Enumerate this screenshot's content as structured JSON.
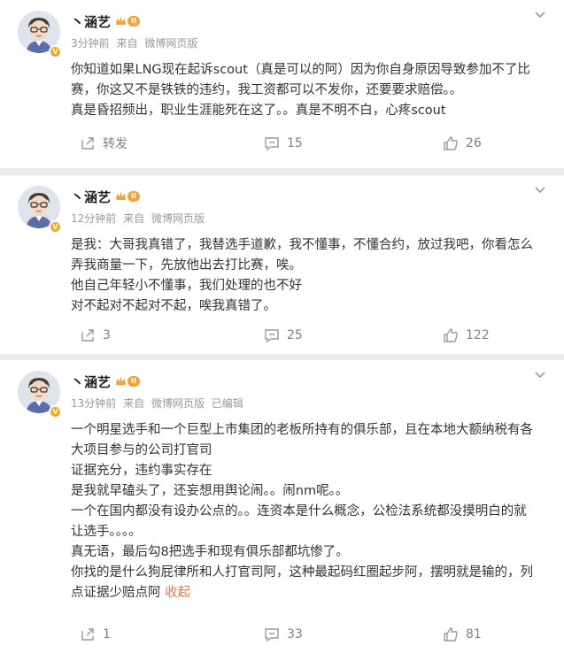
{
  "posts": [
    {
      "user": {
        "name": "丶涵艺",
        "level": "II",
        "verified_badge": "V"
      },
      "meta": {
        "time": "3分钟前",
        "from": "来自",
        "source": "微博网页版",
        "edited": ""
      },
      "lines": [
        "你知道如果LNG现在起诉scout（真是可以的阿）因为你自身原因导致参加不了比",
        "赛，你这又不是铁铁的违约，我工资都可以不发你，还要要求赔偿。。",
        "真是昏招频出，职业生涯能死在这了。。真是不明不白，心疼scout"
      ],
      "collapse_label": "",
      "actions": {
        "repost": "转发",
        "comment": "15",
        "like": "26"
      }
    },
    {
      "user": {
        "name": "丶涵艺",
        "level": "II",
        "verified_badge": "V"
      },
      "meta": {
        "time": "12分钟前",
        "from": "来自",
        "source": "微博网页版",
        "edited": ""
      },
      "lines": [
        "是我：大哥我真错了，我替选手道歉，我不懂事，不懂合约，放过我吧，你看怎么",
        "弄我商量一下，先放他出去打比赛，唉。",
        "他自己年轻小不懂事，我们处理的也不好",
        "对不起对不起对不起，唉我真错了。"
      ],
      "collapse_label": "",
      "actions": {
        "repost": "3",
        "comment": "25",
        "like": "122"
      }
    },
    {
      "user": {
        "name": "丶涵艺",
        "level": "II",
        "verified_badge": "V"
      },
      "meta": {
        "time": "13分钟前",
        "from": "来自",
        "source": "微博网页版",
        "edited": "已编辑"
      },
      "lines": [
        "一个明星选手和一个巨型上市集团的老板所持有的俱乐部，且在本地大额纳税有各",
        "大项目参与的公司打官司",
        "证据充分，违约事实存在",
        "是我就早磕头了，还妄想用舆论闹。。闹nm呢。。",
        "一个在国内都没有设办公点的。。连资本是什么概念，公检法系统都没摸明白的就",
        "让选手。。。。",
        "真无语，最后勾8把选手和现有俱乐部都坑惨了。",
        "你找的是什么狗屁律所和人打官司阿，这种最起码红圈起步阿，摆明就是输的，列",
        "点证据少赔点阿"
      ],
      "collapse_label": "收起",
      "actions": {
        "repost": "1",
        "comment": "33",
        "like": "81"
      }
    }
  ],
  "icons": {
    "more": "chevron-down-icon",
    "repost": "repost-icon",
    "comment": "comment-icon",
    "like": "like-icon"
  },
  "colors": {
    "collapse": "#eb7350",
    "level_badge": "#f2a33a",
    "meta": "#999999"
  }
}
